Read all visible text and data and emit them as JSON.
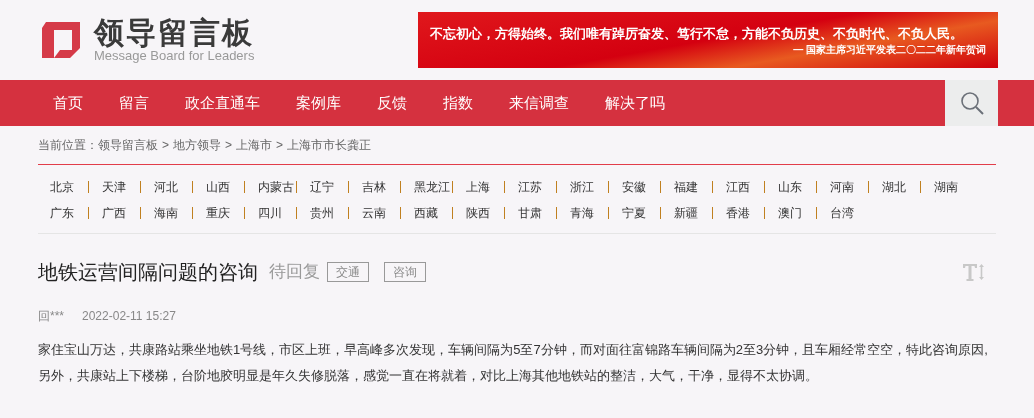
{
  "logo": {
    "title": "领导留言板",
    "subtitle": "Message Board for Leaders"
  },
  "banner": {
    "quote": "不忘初心，方得始终。我们唯有踔厉奋发、笃行不怠，方能不负历史、不负时代、不负人民。",
    "source": "— 国家主席习近平发表二〇二二年新年贺词"
  },
  "nav": [
    {
      "label": "首页"
    },
    {
      "label": "留言"
    },
    {
      "label": "政企直通车"
    },
    {
      "label": "案例库"
    },
    {
      "label": "反馈"
    },
    {
      "label": "指数"
    },
    {
      "label": "来信调查"
    },
    {
      "label": "解决了吗"
    }
  ],
  "breadcrumb": {
    "label": "当前位置：",
    "separator": ">",
    "items": [
      "领导留言板",
      "地方领导",
      "上海市",
      "上海市市长龚正"
    ]
  },
  "regions": [
    "北京",
    "天津",
    "河北",
    "山西",
    "内蒙古",
    "辽宁",
    "吉林",
    "黑龙江",
    "上海",
    "江苏",
    "浙江",
    "安徽",
    "福建",
    "江西",
    "山东",
    "河南",
    "湖北",
    "湖南",
    "广东",
    "广西",
    "海南",
    "重庆",
    "四川",
    "贵州",
    "云南",
    "西藏",
    "陕西",
    "甘肃",
    "青海",
    "宁夏",
    "新疆",
    "香港",
    "澳门",
    "台湾"
  ],
  "message": {
    "title": "地铁运营间隔问题的咨询",
    "status": "待回复",
    "tags": [
      "交通",
      "咨询"
    ],
    "author": "回***",
    "time": "2022-02-11 15:27",
    "body": "家住宝山万达，共康路站乘坐地铁1号线，市区上班，早高峰多次发现，车辆间隔为5至7分钟，而对面往富锦路车辆间隔为2至3分钟，且车厢经常空空，特此咨询原因, 另外，共康站上下楼梯，台阶地胶明显是年久失修脱落，感觉一直在将就着，对比上海其他地铁站的整洁，大气，干净，显得不太协调。"
  }
}
